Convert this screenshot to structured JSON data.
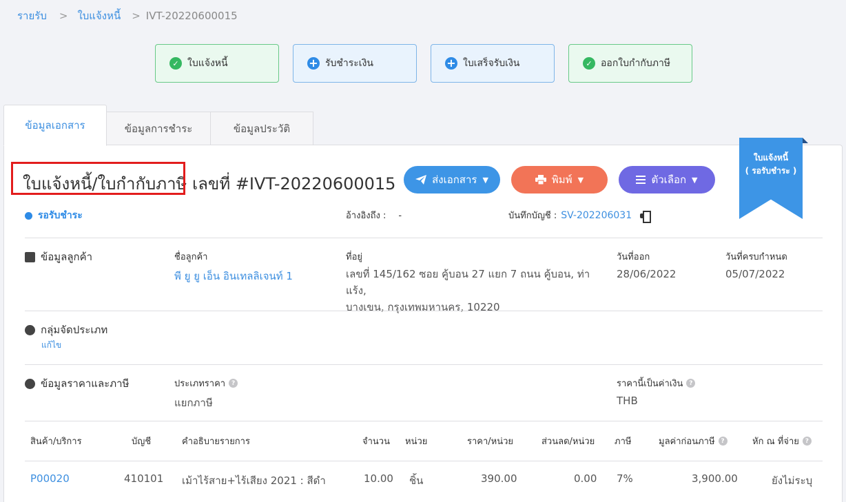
{
  "breadcrumb": {
    "level1": "รายรับ",
    "level2": "ใบแจ้งหนี้",
    "current": "IVT-20220600015",
    "sep": ">"
  },
  "steps": [
    {
      "label": "ใบแจ้งหนี้",
      "icon": "check-circle-icon",
      "state": "done"
    },
    {
      "label": "รับชำระเงิน",
      "icon": "plus-circle-icon",
      "state": "action"
    },
    {
      "label": "ใบเสร็จรับเงิน",
      "icon": "plus-circle-icon",
      "state": "action"
    },
    {
      "label": "ออกใบกำกับภาษี",
      "icon": "check-circle-icon",
      "state": "done"
    }
  ],
  "tabs": [
    {
      "label": "ข้อมูลเอกสาร",
      "active": true
    },
    {
      "label": "ข้อมูลการชำระ",
      "active": false
    },
    {
      "label": "ข้อมูลประวัติ",
      "active": false
    }
  ],
  "document": {
    "type_label": "ใบแจ้งหนี้/ใบกำกับภาษี",
    "number_label": "เลขที่ #IVT-20220600015",
    "status": "รอรับชำระ",
    "ref_label": "อ้างอิงถึง :",
    "ref_value": "-",
    "record_label": "บันทึกบัญชี :",
    "record_value": "SV-202206031"
  },
  "actions": {
    "send": "ส่งเอกสาร",
    "print": "พิมพ์",
    "options": "ตัวเลือก"
  },
  "ribbon": {
    "line1": "ใบแจ้งหนี้",
    "line2": "( รอรับชำระ )"
  },
  "customer": {
    "section": "ข้อมูลลูกค้า",
    "name_label": "ชื่อลูกค้า",
    "name": "พี ยู ยู เอ็น อินเทลลิเจนท์ 1",
    "address_label": "ที่อยู่",
    "address_line1": "เลขที่ 145/162 ซอย คู้บอน 27 แยก 7 ถนน คู้บอน, ท่าแร้ง,",
    "address_line2": "บางเขน, กรุงเทพมหานคร, 10220",
    "issue_label": "วันที่ออก",
    "issue_date": "28/06/2022",
    "due_label": "วันที่ครบกำหนด",
    "due_date": "05/07/2022"
  },
  "category": {
    "section": "กลุ่มจัดประเภท",
    "edit": "แก้ไข"
  },
  "pricing": {
    "section": "ข้อมูลราคาและภาษี",
    "type_label": "ประเภทราคา",
    "type_value": "แยกภาษี",
    "currency_label": "ราคานี้เป็นค่าเงิน",
    "currency_value": "THB"
  },
  "table": {
    "headers": [
      "สินค้า/บริการ",
      "บัญชี",
      "คำอธิบายรายการ",
      "จำนวน",
      "หน่วย",
      "ราคา/หน่วย",
      "ส่วนลด/หน่วย",
      "ภาษี",
      "มูลค่าก่อนภาษี",
      "หัก ณ ที่จ่าย"
    ],
    "rows": [
      [
        "P00020",
        "410101",
        "เม้าไร้สาย+ไร้เสียง 2021 : สีดำ",
        "10.00",
        "ชิ้น",
        "390.00",
        "0.00",
        "7%",
        "3,900.00",
        "ยังไม่ระบุ"
      ]
    ]
  },
  "colors": {
    "accent": "#3d8fe0",
    "success": "#35b861",
    "print": "#f27457",
    "options": "#6f69e3",
    "highlight": "#e21c1c"
  }
}
